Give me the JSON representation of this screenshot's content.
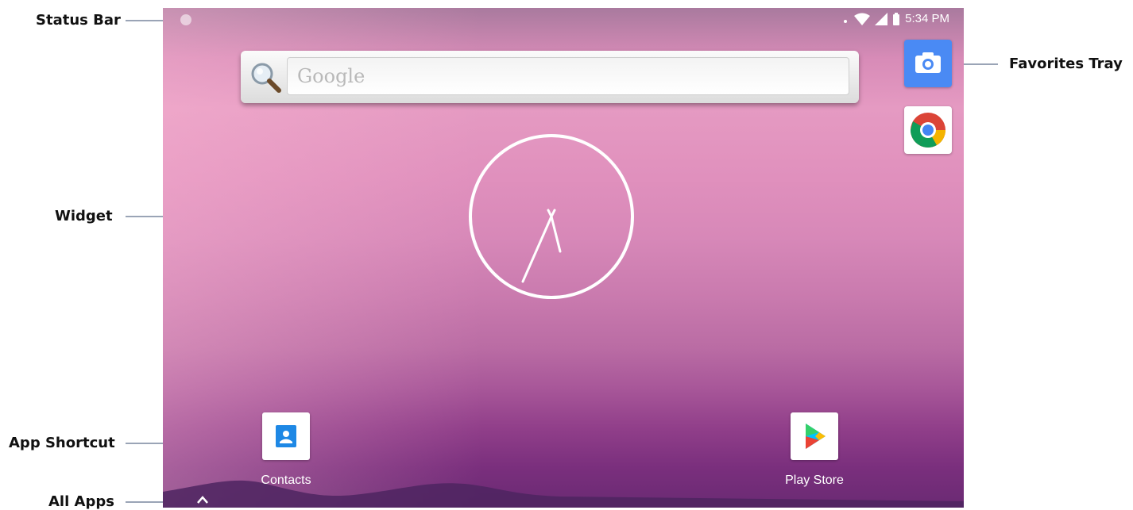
{
  "annotations": {
    "status_bar": "Status Bar",
    "widget": "Widget",
    "app_shortcut": "App Shortcut",
    "all_apps": "All Apps",
    "favorites_tray": "Favorites Tray"
  },
  "status_bar": {
    "time": "5:34 PM",
    "icons": [
      "notification-dot-icon",
      "data-arrows-icon",
      "wifi-icon",
      "cell-signal-icon",
      "battery-icon"
    ]
  },
  "search": {
    "placeholder": "Google",
    "icon": "magnifier-icon"
  },
  "widget": {
    "type": "analog-clock",
    "icon": "clock-icon"
  },
  "favorites_tray": {
    "items": [
      {
        "name": "Camera",
        "icon": "camera-icon",
        "color": "#4a8af4"
      },
      {
        "name": "Chrome",
        "icon": "chrome-icon",
        "color": "#ffffff"
      }
    ]
  },
  "shortcuts": [
    {
      "label": "Contacts",
      "icon": "contacts-icon",
      "color": "#1e88e5"
    },
    {
      "label": "Play Store",
      "icon": "play-store-icon",
      "color": "#ffffff"
    }
  ],
  "all_apps": {
    "icon": "chevron-up-icon"
  },
  "colors": {
    "wallpaper_top": "#d78bb7",
    "wallpaper_bottom": "#6a2a73",
    "leader_line": "#9aa4b6"
  }
}
